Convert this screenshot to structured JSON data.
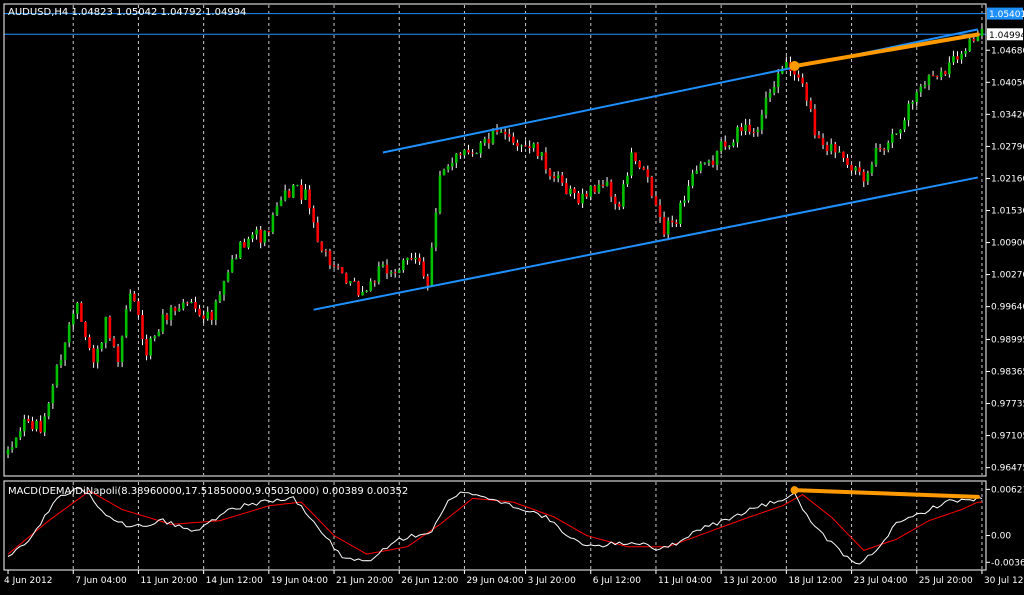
{
  "main_label": "AUDUSD,H4  1.04823 1.05042 1.04792 1.04994",
  "indicator_label": "MACD(DEMA)DiNapoli(8.38960000,17.51850000,9.05030000) 0.00389 0.00352",
  "colors": {
    "background": "#000000",
    "frame": "#ffffff",
    "grid": "#c8c8c8",
    "bull": "#00c000",
    "bear": "#ff0000",
    "wick": "#ffffff",
    "channel": "#1e90ff",
    "annotation": "#ff9900",
    "macd_line": "#ffffff",
    "signal_line": "#ff0000",
    "highlight_tag_bg": "#1e90ff"
  },
  "chart_data": {
    "type": "candlestick",
    "symbol": "AUDUSD",
    "timeframe": "H4",
    "ohlc_readout": {
      "open": 1.04823,
      "high": 1.05042,
      "low": 1.04792,
      "close": 1.04994
    },
    "y_ticks": [
      "1.04680",
      "1.04050",
      "1.03420",
      "1.02790",
      "1.02160",
      "1.01530",
      "1.00900",
      "1.00270",
      "0.99640",
      "0.98995",
      "0.98365",
      "0.97735",
      "0.97105",
      "0.96475"
    ],
    "ylim": [
      0.9633,
      1.0557
    ],
    "x_ticks": [
      "4 Jun 2012",
      "7 Jun 04:00",
      "11 Jun 20:00",
      "14 Jun 12:00",
      "19 Jun 04:00",
      "21 Jun 20:00",
      "26 Jun 12:00",
      "29 Jun 04:00",
      "3 Jul 20:00",
      "6 Jul 12:00",
      "11 Jul 04:00",
      "13 Jul 20:00",
      "18 Jul 12:00",
      "23 Jul 04:00",
      "25 Jul 20:00",
      "30 Jul 12:00"
    ],
    "horizontal_levels": [
      {
        "label": "1.05401",
        "value": 1.05401,
        "highlighted": true
      },
      {
        "label": "1.04994",
        "value": 1.04994,
        "highlighted": false
      }
    ],
    "path_anchors": [
      [
        0,
        0.967
      ],
      [
        4,
        0.974
      ],
      [
        8,
        0.972
      ],
      [
        13,
        0.987
      ],
      [
        17,
        0.998
      ],
      [
        21,
        0.985
      ],
      [
        24,
        0.993
      ],
      [
        27,
        0.9845
      ],
      [
        30,
        0.9995
      ],
      [
        34,
        0.988
      ],
      [
        39,
        0.995
      ],
      [
        44,
        0.9975
      ],
      [
        50,
        0.994
      ],
      [
        55,
        1.005
      ],
      [
        59,
        1.011
      ],
      [
        63,
        1.01
      ],
      [
        67,
        1.017
      ],
      [
        70,
        1.02
      ],
      [
        73,
        1.018
      ],
      [
        77,
        1.008
      ],
      [
        82,
        1.0015
      ],
      [
        87,
        0.999
      ],
      [
        91,
        1.003
      ],
      [
        96,
        1.004
      ],
      [
        101,
        1.006
      ],
      [
        103,
        1.001
      ],
      [
        106,
        1.021
      ],
      [
        110,
        1.027
      ],
      [
        115,
        1.0275
      ],
      [
        119,
        1.03
      ],
      [
        125,
        1.029
      ],
      [
        129,
        1.0275
      ],
      [
        133,
        1.023
      ],
      [
        137,
        1.0185
      ],
      [
        141,
        1.018
      ],
      [
        146,
        1.021
      ],
      [
        150,
        1.016
      ],
      [
        153,
        1.026
      ],
      [
        157,
        1.021
      ],
      [
        161,
        1.011
      ],
      [
        164,
        1.014
      ],
      [
        168,
        1.0225
      ],
      [
        172,
        1.024
      ],
      [
        176,
        1.029
      ],
      [
        180,
        1.031
      ],
      [
        184,
        1.032
      ],
      [
        187,
        1.038
      ],
      [
        190,
        1.044
      ],
      [
        193,
        1.042
      ],
      [
        196,
        1.038
      ],
      [
        198,
        1.031
      ],
      [
        201,
        1.028
      ],
      [
        205,
        1.027
      ],
      [
        208,
        1.023
      ],
      [
        210,
        1.02
      ],
      [
        213,
        1.027
      ],
      [
        217,
        1.03
      ],
      [
        220,
        1.034
      ],
      [
        224,
        1.04
      ],
      [
        227,
        1.042
      ],
      [
        231,
        1.044
      ],
      [
        235,
        1.048
      ],
      [
        238,
        1.0499
      ]
    ],
    "channel_lines": [
      {
        "name": "upper",
        "points": [
          [
            92,
            1.0267
          ],
          [
            238,
            1.0509
          ]
        ]
      },
      {
        "name": "lower",
        "points": [
          [
            75,
            0.9958
          ],
          [
            238,
            1.0218
          ]
        ]
      }
    ],
    "annotation_line_main": {
      "points": [
        [
          193,
          1.0437
        ],
        [
          238,
          1.0499
        ]
      ]
    },
    "indicator": {
      "name": "MACD(DEMA)DiNapoli",
      "params": [
        8.3896,
        17.5185,
        9.0503
      ],
      "values": {
        "macd": 0.00389,
        "signal": 0.00352
      },
      "y_ticks": [
        "0.00621",
        "0.00",
        "-0.0036"
      ],
      "ylim": [
        -0.0045,
        0.0072
      ],
      "macd_anchors": [
        [
          0,
          -0.003
        ],
        [
          6,
          0.0
        ],
        [
          12,
          0.005
        ],
        [
          18,
          0.0065
        ],
        [
          24,
          0.003
        ],
        [
          30,
          0.001
        ],
        [
          38,
          0.002
        ],
        [
          46,
          0.0005
        ],
        [
          54,
          0.0035
        ],
        [
          62,
          0.0045
        ],
        [
          70,
          0.005
        ],
        [
          77,
          0.0005
        ],
        [
          82,
          -0.003
        ],
        [
          88,
          -0.0035
        ],
        [
          96,
          -0.0005
        ],
        [
          104,
          0.0005
        ],
        [
          108,
          0.0045
        ],
        [
          112,
          0.006
        ],
        [
          118,
          0.005
        ],
        [
          124,
          0.004
        ],
        [
          132,
          0.0025
        ],
        [
          138,
          -0.0005
        ],
        [
          144,
          -0.0015
        ],
        [
          150,
          -0.001
        ],
        [
          156,
          -0.001
        ],
        [
          160,
          -0.002
        ],
        [
          164,
          -0.001
        ],
        [
          170,
          0.001
        ],
        [
          176,
          0.002
        ],
        [
          182,
          0.0035
        ],
        [
          188,
          0.0045
        ],
        [
          193,
          0.0055
        ],
        [
          198,
          0.001
        ],
        [
          203,
          -0.0015
        ],
        [
          208,
          -0.004
        ],
        [
          212,
          -0.0025
        ],
        [
          218,
          0.0015
        ],
        [
          224,
          0.003
        ],
        [
          230,
          0.0045
        ],
        [
          238,
          0.005
        ]
      ],
      "signal_anchors": [
        [
          0,
          -0.0025
        ],
        [
          10,
          0.002
        ],
        [
          20,
          0.006
        ],
        [
          28,
          0.0035
        ],
        [
          40,
          0.0015
        ],
        [
          52,
          0.002
        ],
        [
          64,
          0.004
        ],
        [
          72,
          0.0045
        ],
        [
          80,
          0.0
        ],
        [
          88,
          -0.0025
        ],
        [
          98,
          -0.0015
        ],
        [
          106,
          0.0015
        ],
        [
          114,
          0.005
        ],
        [
          124,
          0.0045
        ],
        [
          134,
          0.0025
        ],
        [
          142,
          0.0
        ],
        [
          152,
          -0.0015
        ],
        [
          162,
          -0.0015
        ],
        [
          172,
          0.0005
        ],
        [
          182,
          0.0025
        ],
        [
          190,
          0.004
        ],
        [
          195,
          0.0055
        ],
        [
          202,
          0.0025
        ],
        [
          210,
          -0.002
        ],
        [
          218,
          -0.0005
        ],
        [
          226,
          0.002
        ],
        [
          234,
          0.0035
        ],
        [
          238,
          0.0045
        ]
      ],
      "annotation_line": {
        "points": [
          [
            193,
            0.0061
          ],
          [
            238,
            0.0052
          ]
        ]
      }
    }
  }
}
